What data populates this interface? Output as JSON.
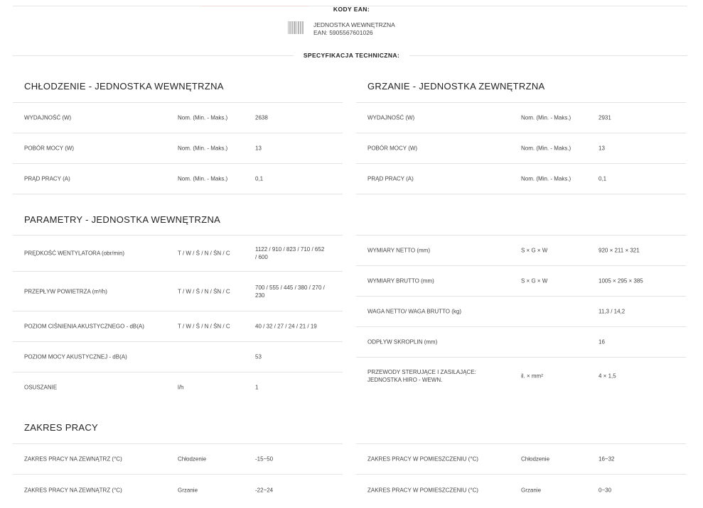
{
  "ean": {
    "heading": "KODY EAN:",
    "unit_name": "JEDNOSTKA WEWNĘTRZNA",
    "code": "EAN: 5905567601026"
  },
  "spec_heading": "SPECYFIKACJA TECHNICZNA:",
  "sections": {
    "cooling_indoor": {
      "title": "CHŁODZENIE - JEDNOSTKA WEWNĘTRZNA",
      "rows": [
        {
          "label": "WYDAJNOŚĆ (W)",
          "mode": "Nom. (Min. - Maks.)",
          "value": "2638"
        },
        {
          "label": "POBÓR MOCY (W)",
          "mode": "Nom. (Min. - Maks.)",
          "value": "13"
        },
        {
          "label": "PRĄD PRACY (A)",
          "mode": "Nom. (Min. - Maks.)",
          "value": "0,1"
        }
      ]
    },
    "heating_outdoor": {
      "title": "GRZANIE - JEDNOSTKA ZEWNĘTRZNA",
      "rows": [
        {
          "label": "WYDAJNOŚĆ (W)",
          "mode": "Nom. (Min. - Maks.)",
          "value": "2931"
        },
        {
          "label": "POBÓR MOCY (W)",
          "mode": "Nom. (Min. - Maks.)",
          "value": "13"
        },
        {
          "label": "PRĄD PRACY (A)",
          "mode": "Nom. (Min. - Maks.)",
          "value": "0,1"
        }
      ]
    },
    "params_indoor": {
      "title": "PARAMETRY - JEDNOSTKA WEWNĘTRZNA",
      "left_rows": [
        {
          "label": "PRĘDKOŚĆ WENTYLATORA (obr/min)",
          "mode": "T / W / Ś / N / ŚN / C",
          "value": "1122 / 910 / 823 / 710 / 652 / 600"
        },
        {
          "label": "PRZEPŁYW POWIETRZA (m³/h)",
          "mode": "T / W / Ś / N / ŚN / C",
          "value": "700 / 555 / 445 / 380 / 270 / 230"
        },
        {
          "label": "POZIOM CIŚNIENIA AKUSTYCZNEGO - dB(A)",
          "mode": "T / W / Ś / N / ŚN / C",
          "value": "40 / 32 / 27 / 24 / 21 / 19"
        },
        {
          "label": "POZIOM MOCY AKUSTYCZNEJ - dB(A)",
          "mode": "",
          "value": "53"
        },
        {
          "label": "OSUSZANIE",
          "mode": "l/h",
          "value": "1"
        }
      ],
      "right_rows": [
        {
          "label": "WYMIARY NETTO (mm)",
          "mode": "S × G × W",
          "value": "920 × 211 × 321"
        },
        {
          "label": "WYMIARY BRUTTO (mm)",
          "mode": "S × G × W",
          "value": "1005 × 295 × 385"
        },
        {
          "label": "WAGA NETTO/ WAGA BRUTTO (kg)",
          "mode": "",
          "value": "11,3 / 14,2"
        },
        {
          "label": "ODPŁYW SKROPLIN (mm)",
          "mode": "",
          "value": "16"
        },
        {
          "label": "PRZEWODY STERUJĄCE I ZASILAJĄCE: JEDNOSTKA HIRO - WEWN.",
          "mode": "il. × mm²",
          "value": "4 × 1,5"
        }
      ]
    },
    "range": {
      "title": "ZAKRES PRACY",
      "left_rows": [
        {
          "label": "ZAKRES PRACY NA ZEWNĄTRZ (°C)",
          "mode": "Chłodzenie",
          "value": "-15~50"
        },
        {
          "label": "ZAKRES PRACY NA ZEWNĄTRZ (°C)",
          "mode": "Grzanie",
          "value": "-22~24"
        }
      ],
      "right_rows": [
        {
          "label": "ZAKRES PRACY W POMIESZCZENIU (°C)",
          "mode": "Chłodzenie",
          "value": "16~32"
        },
        {
          "label": "ZAKRES PRACY W POMIESZCZENIU (°C)",
          "mode": "Grzanie",
          "value": "0~30"
        }
      ]
    }
  }
}
